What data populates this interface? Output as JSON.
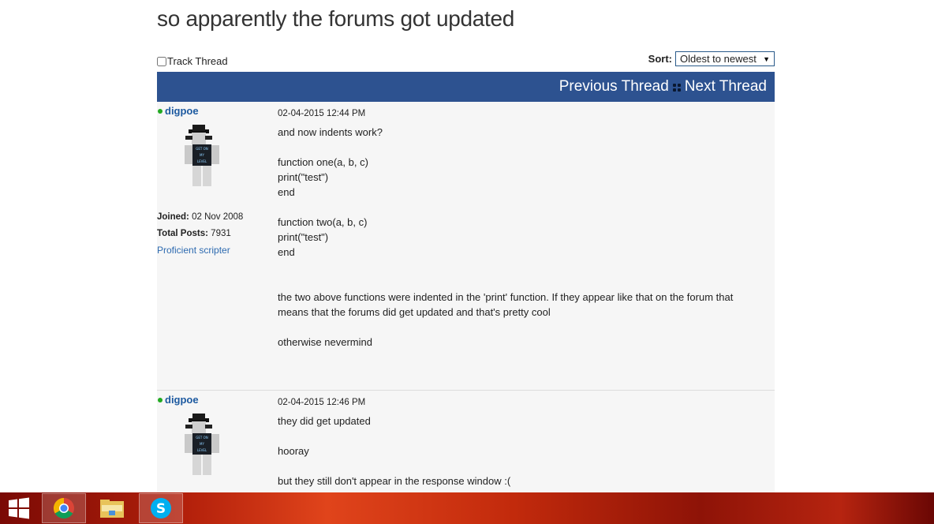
{
  "thread": {
    "title": "so apparently the forums got updated",
    "track_label": "Track Thread",
    "sort_label": "Sort:",
    "sort_value": "Oldest to newest",
    "nav": {
      "previous": "Previous Thread",
      "next": "Next Thread"
    }
  },
  "posts": [
    {
      "username": "digpoe",
      "joined_label": "Joined:",
      "joined": "02 Nov 2008",
      "total_posts_label": "Total Posts:",
      "total_posts": "7931",
      "rank": "Proficient scripter",
      "date": "02-04-2015 12:44 PM",
      "lines": [
        "and now indents work?",
        "",
        "function one(a, b, c)",
        "print(\"test\")",
        "end",
        "",
        "function two(a, b, c)",
        "print(\"test\")",
        "end",
        "",
        "",
        "the two above functions were indented in the 'print' function. If they appear like that on the forum that",
        "means that the forums did get updated and that's pretty cool",
        "",
        "otherwise nevermind"
      ]
    },
    {
      "username": "digpoe",
      "date": "02-04-2015 12:46 PM",
      "lines": [
        "they did get updated",
        "",
        "hooray",
        "",
        "but they still don't appear in the response window :("
      ]
    }
  ],
  "avatar_shirt_text": "GET ON MY LEVEL",
  "taskbar": {
    "items": [
      "windows-start",
      "chrome",
      "file-explorer",
      "skype"
    ]
  },
  "colors": {
    "nav_bar": "#2d5290",
    "username": "#1d5aa0",
    "online": "#22aa22",
    "post_bg": "#f6f6f6"
  }
}
